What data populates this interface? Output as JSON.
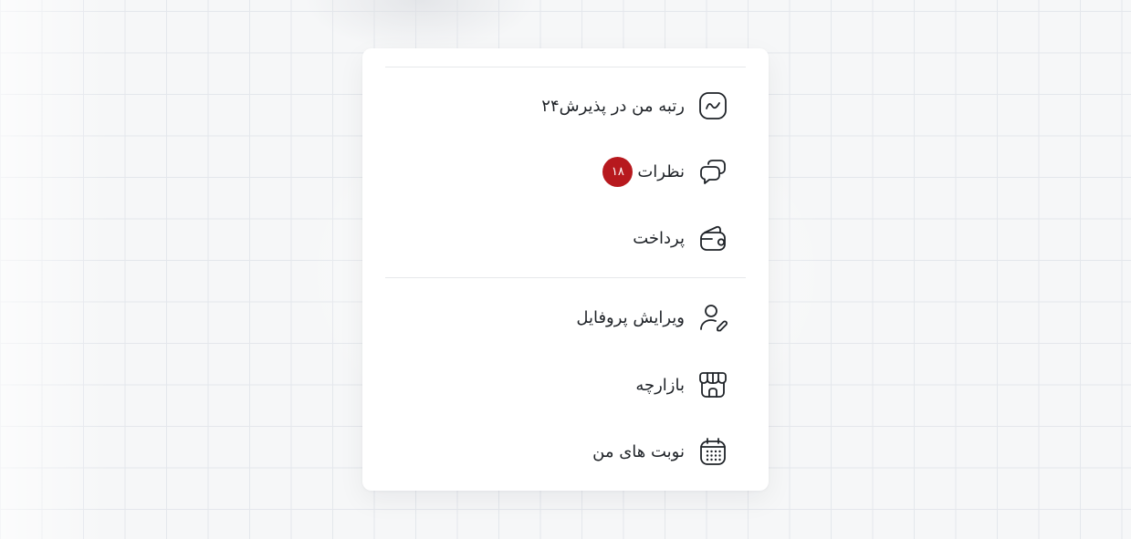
{
  "menu": {
    "items": [
      {
        "label": "رتبه من در پذیرش۲۴",
        "icon": "trend-chart-icon"
      },
      {
        "label": "نظرات",
        "icon": "chat-bubbles-icon",
        "badge": "۱۸"
      },
      {
        "label": "پرداخت",
        "icon": "wallet-icon"
      },
      {
        "label": "ویرایش پروفایل",
        "icon": "user-edit-icon"
      },
      {
        "label": "بازارچه",
        "icon": "shop-icon"
      },
      {
        "label": "نوبت های من",
        "icon": "calendar-icon"
      }
    ]
  },
  "colors": {
    "badge": "#b7191e",
    "text": "#1f2328",
    "divider": "#e6e8eb"
  }
}
